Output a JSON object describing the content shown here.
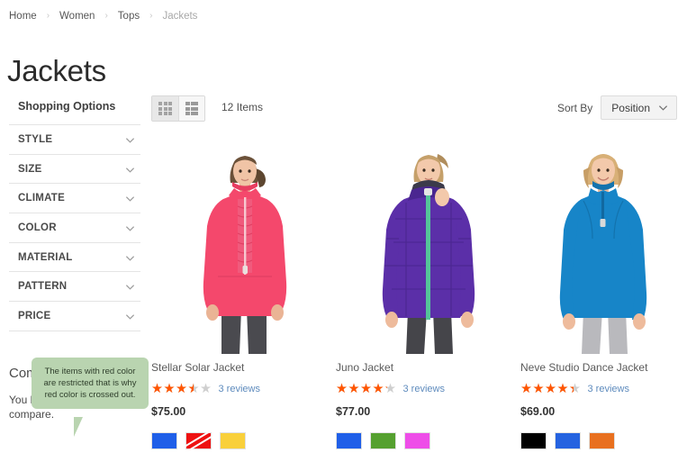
{
  "breadcrumb": {
    "separator": "›",
    "items": [
      {
        "label": "Home"
      },
      {
        "label": "Women"
      },
      {
        "label": "Tops"
      },
      {
        "label": "Jackets"
      }
    ]
  },
  "page": {
    "title": "Jackets"
  },
  "sidebar": {
    "title": "Shopping Options",
    "filters": [
      {
        "label": "STYLE"
      },
      {
        "label": "SIZE"
      },
      {
        "label": "CLIMATE"
      },
      {
        "label": "COLOR"
      },
      {
        "label": "MATERIAL"
      },
      {
        "label": "PATTERN"
      },
      {
        "label": "PRICE"
      }
    ]
  },
  "compare": {
    "title": "Compare Products",
    "empty_text": "You have no items to compare."
  },
  "tooltip": {
    "text": "The items with red color are restricted that is why red color is crossed out.",
    "background_color": "#b9d4b0"
  },
  "toolbar": {
    "view_grid_icon": "grid-view-icon",
    "view_list_icon": "list-view-icon",
    "items_count": "12 Items",
    "sort_label": "Sort By",
    "sort_value": "Position",
    "sort_chevron_icon": "chevron-down-icon"
  },
  "products": [
    {
      "name": "Stellar Solar Jacket",
      "rating_percent": 70,
      "stars_glyphs": "★★★★★",
      "reviews": "3 reviews",
      "price": "$75.00",
      "swatches": [
        {
          "name": "blue",
          "color": "#1f5fe8",
          "restricted": false
        },
        {
          "name": "red",
          "color": "#ee1111",
          "restricted": true
        },
        {
          "name": "yellow",
          "color": "#f9d03b",
          "restricted": false
        }
      ]
    },
    {
      "name": "Juno Jacket",
      "rating_percent": 84,
      "stars_glyphs": "★★★★★",
      "reviews": "3 reviews",
      "price": "$77.00",
      "swatches": [
        {
          "name": "blue",
          "color": "#1f5fe8",
          "restricted": false
        },
        {
          "name": "green",
          "color": "#55a02f",
          "restricted": false
        },
        {
          "name": "magenta",
          "color": "#ee4de8",
          "restricted": false
        }
      ]
    },
    {
      "name": "Neve Studio Dance Jacket",
      "rating_percent": 88,
      "stars_glyphs": "★★★★★",
      "reviews": "3 reviews",
      "price": "$69.00",
      "swatches": [
        {
          "name": "black",
          "color": "#000000",
          "restricted": false
        },
        {
          "name": "blue",
          "color": "#2563e0",
          "restricted": false
        },
        {
          "name": "orange",
          "color": "#e8701f",
          "restricted": false
        }
      ]
    }
  ],
  "colors": {
    "star_filled": "#ff5501",
    "star_empty": "#cfcfcf",
    "review_link": "#5e8bbd"
  }
}
